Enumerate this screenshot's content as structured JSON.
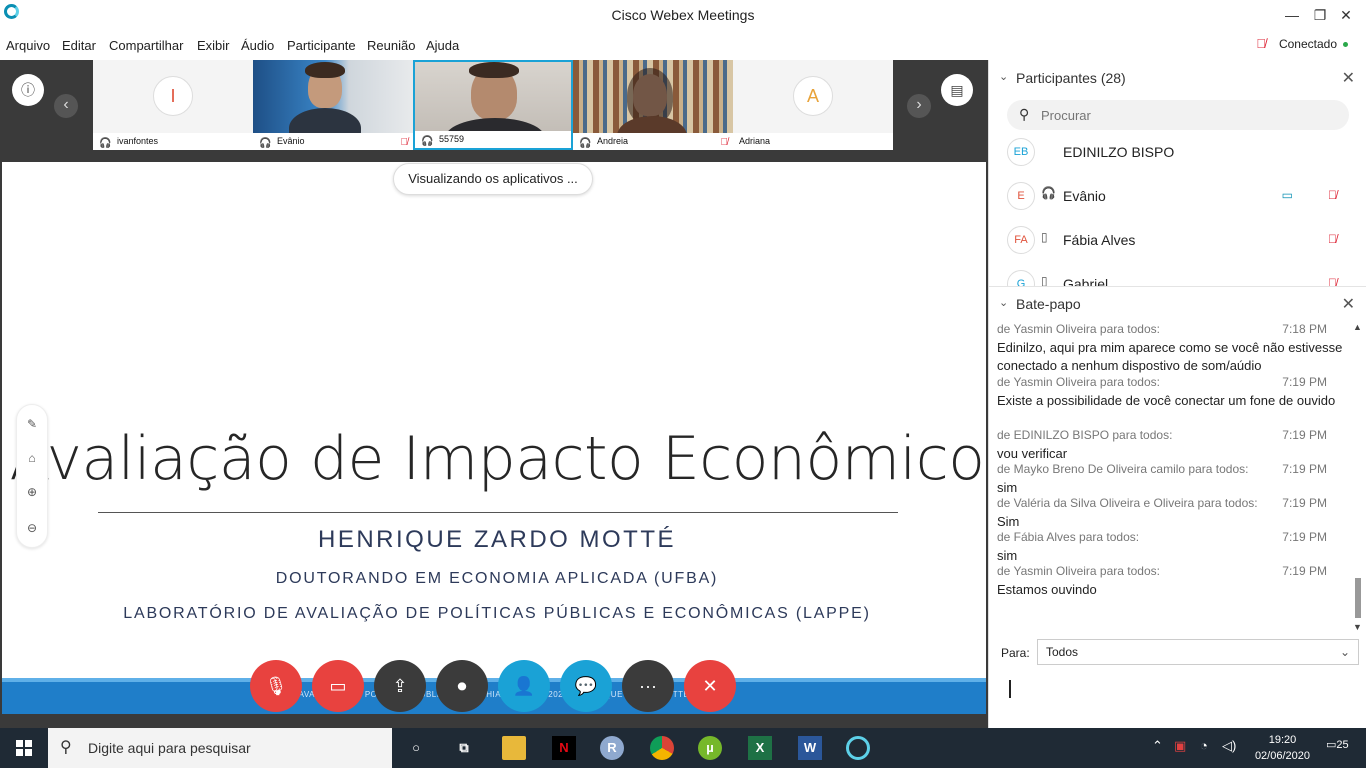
{
  "window": {
    "title": "Cisco Webex Meetings",
    "min": "—",
    "max": "❐",
    "close": "✕"
  },
  "menu": [
    "Arquivo",
    "Editar",
    "Compartilhar",
    "Exibir",
    "Áudio",
    "Participante",
    "Reunião",
    "Ajuda"
  ],
  "status": {
    "label": "Conectado",
    "color": "#2aa84a"
  },
  "videos": [
    {
      "name": "ivanfontes",
      "initial": "I",
      "initial_color": "#e0533c",
      "has_video": false
    },
    {
      "name": "Evânio",
      "has_video": true
    },
    {
      "name": "55759",
      "has_video": true,
      "active": true
    },
    {
      "name": "Andreia",
      "has_video": true
    },
    {
      "name": "Adriana",
      "initial": "A",
      "initial_color": "#e8a33a",
      "has_video": false
    }
  ],
  "share_status": "Visualizando os aplicativos ...",
  "slide": {
    "title": "Avaliação de Impacto Econômico",
    "author": "HENRIQUE ZARDO MOTTÉ",
    "line1": "DOUTORANDO EM ECONOMIA APLICADA (UFBA)",
    "line2": "LABORATÓRIO DE AVALIAÇÃO DE POLÍTICAS PÚBLICAS E ECONÔMICAS (LAPPE)",
    "footer": "AVALIAÇÃO DE POLÍTICAS PÚBLICAS NA BAHIA - GESTÃO 2020 · HENRIQUE ZARDO MOTTÉ"
  },
  "controls": [
    {
      "name": "mute-button",
      "icon": "mic-off-icon",
      "glyph": "🎙",
      "color": "#e8423f"
    },
    {
      "name": "video-button",
      "icon": "video-off-icon",
      "glyph": "▭",
      "color": "#e8423f"
    },
    {
      "name": "share-button",
      "icon": "share-icon",
      "glyph": "⇪",
      "color": "#3b3b3b"
    },
    {
      "name": "record-button",
      "icon": "record-icon",
      "glyph": "⏺",
      "color": "#3b3b3b"
    },
    {
      "name": "participants-button",
      "icon": "participants-icon",
      "glyph": "👤",
      "color": "#1aa2d6"
    },
    {
      "name": "chat-button",
      "icon": "chat-icon",
      "glyph": "💬",
      "color": "#1aa2d6"
    },
    {
      "name": "more-button",
      "icon": "more-icon",
      "glyph": "···",
      "color": "#3b3b3b"
    },
    {
      "name": "leave-button",
      "icon": "close-icon",
      "glyph": "✕",
      "color": "#e8423f"
    }
  ],
  "participants": {
    "title": "Participantes (28)",
    "search_placeholder": "Procurar",
    "list": [
      {
        "initials": "EB",
        "name": "EDINILZO BISPO",
        "color": "#1aa2d6"
      },
      {
        "initials": "E",
        "name": "Evânio",
        "color": "#e0533c",
        "audio": true,
        "video": true,
        "muted": true
      },
      {
        "initials": "FA",
        "name": "Fábia Alves",
        "color": "#e0533c",
        "phone": true,
        "muted": true
      },
      {
        "initials": "G",
        "name": "Gabriel",
        "color": "#1aa2d6",
        "phone": true,
        "muted": true
      }
    ]
  },
  "chat": {
    "title": "Bate-papo",
    "to_label": "Para:",
    "to_value": "Todos",
    "messages": [
      {
        "from": "de Yasmin Oliveira para todos:",
        "time": "7:18 PM",
        "text": "Edinilzo, aqui pra mim aparece como se você não estivesse conectado a nenhum dispostivo de som/aúdio"
      },
      {
        "from": "de Yasmin Oliveira para todos:",
        "time": "7:19 PM",
        "text": "Existe a possibilidade de você conectar um fone de ouvido"
      },
      {
        "from": "de EDINILZO BISPO para todos:",
        "time": "7:19 PM",
        "text": "vou verificar"
      },
      {
        "from": "de Mayko Breno De Oliveira camilo para todos:",
        "time": "7:19 PM",
        "text": "sim"
      },
      {
        "from": "de Valéria da Silva Oliveira e Oliveira para todos:",
        "time": "7:19 PM",
        "text": "Sim"
      },
      {
        "from": "de Fábia Alves para todos:",
        "time": "7:19 PM",
        "text": "sim"
      },
      {
        "from": "de Yasmin Oliveira para todos:",
        "time": "7:19 PM",
        "text": "Estamos ouvindo"
      }
    ]
  },
  "taskbar": {
    "search_placeholder": "Digite aqui para pesquisar",
    "time": "19:20",
    "date": "02/06/2020",
    "notifications": "25"
  }
}
